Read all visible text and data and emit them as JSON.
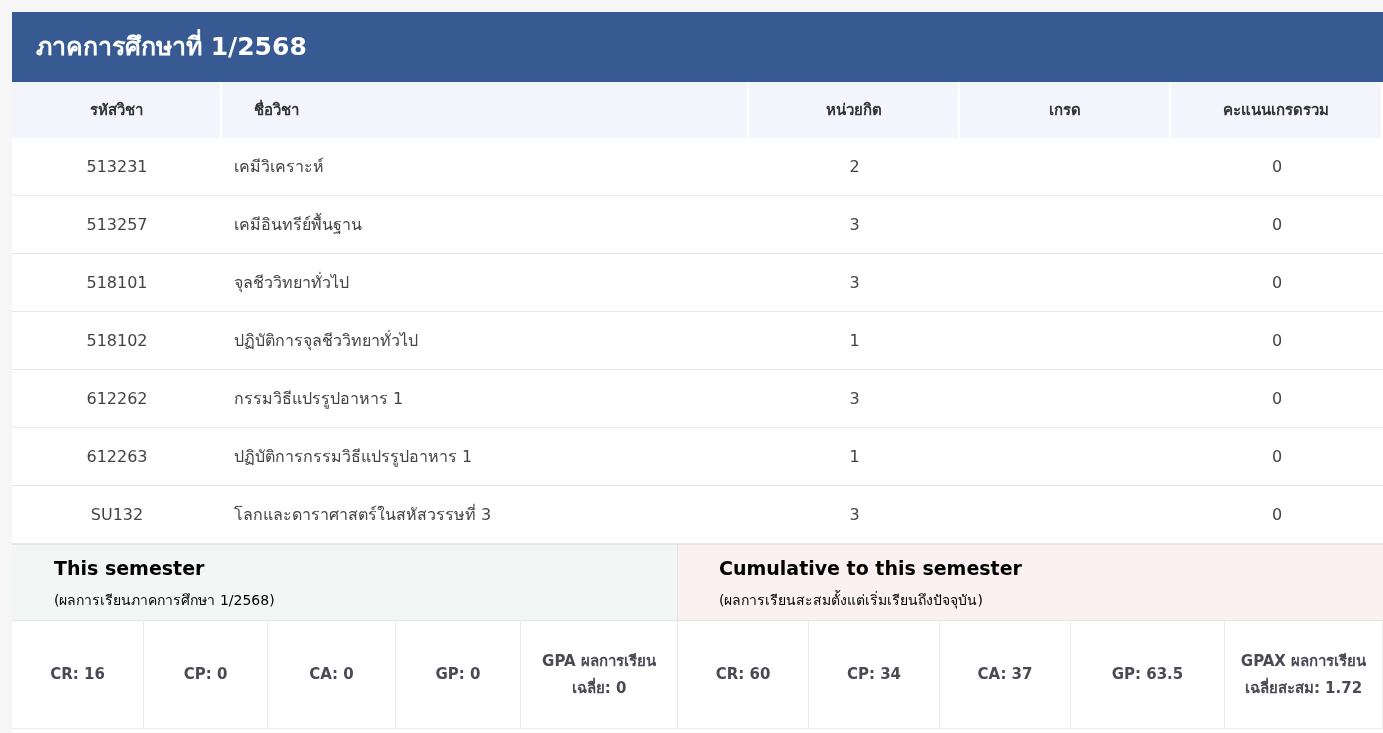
{
  "title": "ภาคการศึกษาที่ 1/2568",
  "table": {
    "columns": [
      "รหัสวิชา",
      "ชื่อวิชา",
      "หน่วยกิต",
      "เกรด",
      "คะแนนเกรดรวม"
    ],
    "rows": [
      {
        "code": "513231",
        "name": "เคมีวิเคราะห์",
        "credits": "2",
        "score": "0"
      },
      {
        "code": "513257",
        "name": "เคมีอินทรีย์พื้นฐาน",
        "credits": "3",
        "score": "0"
      },
      {
        "code": "518101",
        "name": "จุลชีววิทยาทั่วไป",
        "credits": "3",
        "score": "0"
      },
      {
        "code": "518102",
        "name": "ปฏิบัติการจุลชีววิทยาทั่วไป",
        "credits": "1",
        "score": "0"
      },
      {
        "code": "612262",
        "name": "กรรมวิธีแปรรูปอาหาร 1",
        "credits": "3",
        "score": "0"
      },
      {
        "code": "612263",
        "name": "ปฏิบัติการกรรมวิธีแปรรูปอาหาร 1",
        "credits": "1",
        "score": "0"
      },
      {
        "code": "SU132",
        "name": "โลกและดาราศาสตร์ในสหัสวรรษที่ 3",
        "credits": "3",
        "score": "0"
      }
    ]
  },
  "summary": [
    {
      "title": "This semester",
      "subtitle": "(ผลการเรียนภาคการศึกษา 1/2568)",
      "color": "#f2f7f5",
      "stats": [
        "CR: 16",
        "CP: 0",
        "CA: 0",
        "GP: 0",
        "GPA ผลการเรียนเฉลี่ย: 0"
      ]
    },
    {
      "title": "Cumulative to this semester",
      "subtitle": "(ผลการเรียนสะสมตั้งแต่เริ่มเรียนถึงปัจจุบัน)",
      "color": "#fcf1f1",
      "stats": [
        "CR: 60",
        "CP: 34",
        "CA: 37",
        "GP: 63.5",
        "GPAX ผลการเรียนเฉลี่ยสะสม: 1.72"
      ]
    }
  ]
}
